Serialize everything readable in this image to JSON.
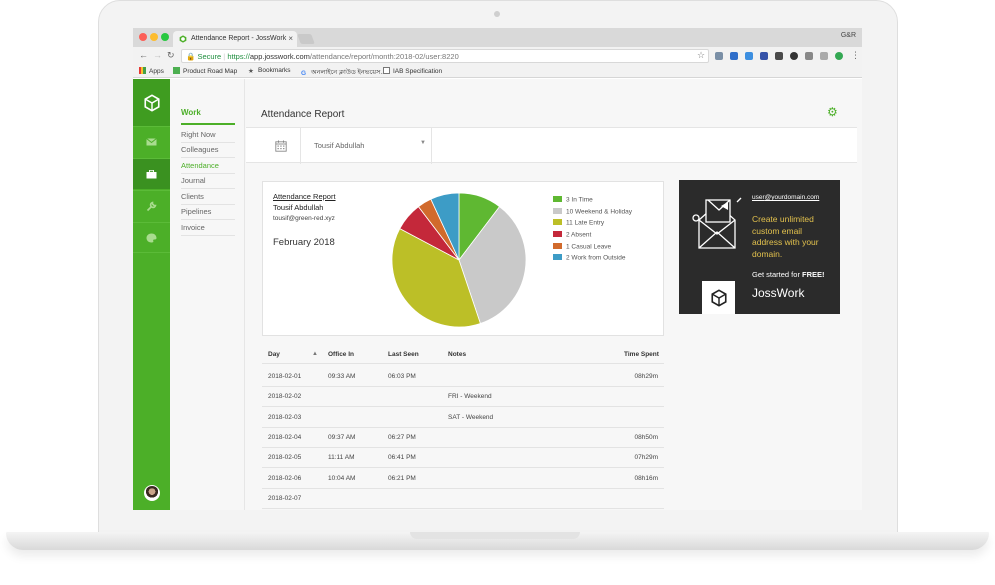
{
  "browser": {
    "tab_title": "Attendance Report - JossWork",
    "tab_close": "×",
    "profile": "G&R",
    "secure_label": "Secure",
    "url_scheme": "https://",
    "url_host": "app.josswork.com",
    "url_path": "/attendance/report/month:2018-02/user:8220",
    "bookmarks": [
      "Apps",
      "Product Road Map",
      "Bookmarks",
      "অনলাইনে ক্লাউড ইনভয়েস...",
      "IAB Specification"
    ]
  },
  "sidebar": {
    "section_title": "Work",
    "items": [
      "Right Now",
      "Colleagues",
      "Attendance",
      "Journal",
      "Clients",
      "Pipelines",
      "Invoice"
    ],
    "active_item": "Attendance"
  },
  "main": {
    "page_title": "Attendance Report",
    "employee_select": "Tousif Abdullah"
  },
  "report": {
    "title": "Attendance Report",
    "name": "Tousif Abdullah",
    "email": "tousif@green-red.xyz",
    "month": "February 2018"
  },
  "chart_data": {
    "type": "pie",
    "labels": [
      "In Time",
      "Weekend & Holiday",
      "Late Entry",
      "Absent",
      "Casual Leave",
      "Work from Outside"
    ],
    "values": [
      3,
      10,
      11,
      2,
      1,
      2
    ],
    "colors": [
      "#5fb832",
      "#c9c9c9",
      "#bcbf27",
      "#c4283a",
      "#d16a2c",
      "#3d9cc6"
    ]
  },
  "legend": [
    {
      "text": "3 In Time"
    },
    {
      "text": "10 Weekend & Holiday"
    },
    {
      "text": "11 Late Entry"
    },
    {
      "text": "2 Absent"
    },
    {
      "text": "1 Casual Leave"
    },
    {
      "text": "2 Work from Outside"
    }
  ],
  "ad": {
    "email_user": "user",
    "email_domain": "@yourdomain.com",
    "headline": "Create unlimited custom email address with your domain.",
    "cta_prefix": "Get started for ",
    "cta_bold": "FREE!",
    "brand": "JossWork"
  },
  "table": {
    "headers": [
      "Day",
      "Office In",
      "Last Seen",
      "Notes",
      "Time Spent"
    ],
    "rows": [
      [
        "2018-02-01",
        "09:33 AM",
        "06:03 PM",
        "",
        "08h29m"
      ],
      [
        "2018-02-02",
        "",
        "",
        "FRI - Weekend",
        ""
      ],
      [
        "2018-02-03",
        "",
        "",
        "SAT - Weekend",
        ""
      ],
      [
        "2018-02-04",
        "09:37 AM",
        "06:27 PM",
        "",
        "08h50m"
      ],
      [
        "2018-02-05",
        "11:11 AM",
        "06:41 PM",
        "",
        "07h29m"
      ],
      [
        "2018-02-06",
        "10:04 AM",
        "06:21 PM",
        "",
        "08h16m"
      ],
      [
        "2018-02-07",
        "",
        "",
        "",
        ""
      ]
    ]
  },
  "colors": {
    "brand_green": "#4caf28",
    "ad_background": "#2b2b2b",
    "ad_headline": "#e2c14d"
  }
}
